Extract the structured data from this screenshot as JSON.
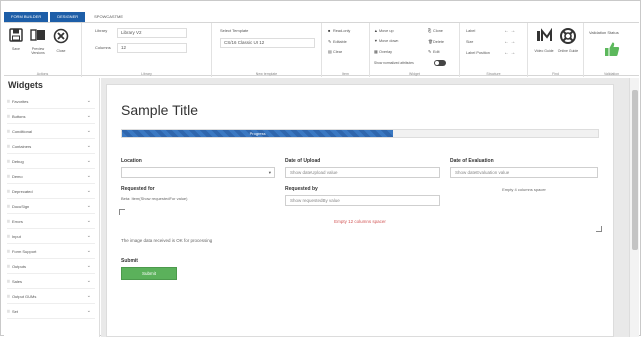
{
  "tabs": [
    {
      "label": "FORM BUILDER",
      "active": true
    },
    {
      "label": "DESIGNER",
      "active": true
    },
    {
      "label": "SPOWCASTME",
      "active": false
    }
  ],
  "ribbon": {
    "groups": {
      "actions": {
        "title": "Actions",
        "buttons": [
          {
            "label": "Save",
            "icon": "save-icon"
          },
          {
            "label": "Preview Versions",
            "icon": "preview-icon"
          },
          {
            "label": "Close",
            "icon": "close-icon"
          }
        ]
      },
      "library": {
        "title": "Library",
        "library_label": "Library",
        "library_value": "Library V2",
        "columns_label": "Columns",
        "columns_value": "12"
      },
      "new_template": {
        "title": "New template",
        "select_label": "Select Template",
        "select_value": "CS/16 Classic UI 12"
      },
      "item": {
        "title": "Item",
        "options": [
          "Read-only",
          "Editable",
          "Clear"
        ]
      },
      "widget": {
        "title": "Widget",
        "move_options": [
          "Move up",
          "Move down",
          "Overlay"
        ],
        "edit_options": [
          "Clone",
          "Delete",
          "Edit"
        ],
        "toggle_label": "Show normalized attributes"
      },
      "structure": {
        "title": "Structure",
        "options": [
          "Label",
          "Size",
          "Label Position"
        ]
      },
      "find": {
        "title": "Find",
        "buttons": [
          {
            "label": "Video Guide",
            "icon": "video-guide-icon"
          },
          {
            "label": "Online Guide",
            "icon": "lifebuoy-icon"
          }
        ]
      },
      "validation": {
        "title": "Validation",
        "status_label": "Validation Status",
        "status_icon": "thumbs-up-icon",
        "status_color": "#5cb85c"
      }
    }
  },
  "sidebar": {
    "title": "Widgets",
    "items": [
      {
        "label": "Favorites"
      },
      {
        "label": "Buttons"
      },
      {
        "label": "Conditional"
      },
      {
        "label": "Containers"
      },
      {
        "label": "Debug"
      },
      {
        "label": "Demo"
      },
      {
        "label": "Deprecated"
      },
      {
        "label": "DocuSign"
      },
      {
        "label": "Errors"
      },
      {
        "label": "Input"
      },
      {
        "label": "Form Support"
      },
      {
        "label": "Outputs"
      },
      {
        "label": "Sales"
      },
      {
        "label": "Output GUMs"
      },
      {
        "label": "Set"
      }
    ]
  },
  "form": {
    "title": "Sample Title",
    "progress": {
      "label": "Progress",
      "value": 0.57,
      "color": "#2f66ad"
    },
    "location": {
      "label": "Location",
      "value": ""
    },
    "date_upload": {
      "label": "Date of Upload",
      "placeholder": "Show dateUpload value"
    },
    "date_evaluation": {
      "label": "Date of Evaluation",
      "placeholder": "Show dateEvaluation value"
    },
    "requested_for": {
      "label": "Requested for",
      "text": "Beta: Item(Show requestedFor value)"
    },
    "requested_by": {
      "label": "Requested by",
      "placeholder": "Show requestedBy value"
    },
    "empty_4": "Empty 4 columns spacer",
    "empty_12": "Empty 12 columns spacer",
    "image_message": "The image data received is OK for processing",
    "submit": {
      "label": "Submit",
      "button": "Submit"
    }
  }
}
